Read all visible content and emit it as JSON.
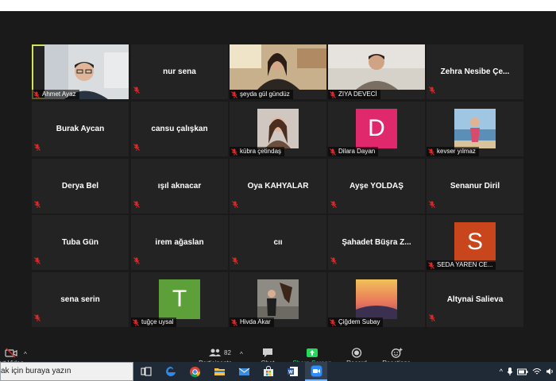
{
  "participants": [
    {
      "name": "Ahmet Ayaz",
      "muted": true,
      "video": true,
      "active_speaker": true,
      "label_style": "bottom"
    },
    {
      "name": "nur sena",
      "muted": true,
      "video": false
    },
    {
      "name": "şeyda gül gündüz",
      "muted": true,
      "video": true
    },
    {
      "name": "ZIYA DEVECİ",
      "muted": true,
      "video": true
    },
    {
      "name": "Zehra Nesibe Çe...",
      "muted": true,
      "video": false
    },
    {
      "name": "Burak Aycan",
      "muted": true,
      "video": false
    },
    {
      "name": "cansu çalışkan",
      "muted": true,
      "video": false
    },
    {
      "name": "kübra çetindaş",
      "muted": true,
      "video": true
    },
    {
      "name": "Dilara Dayan",
      "muted": true,
      "avatar_letter": "D",
      "avatar_color": "#e0286d"
    },
    {
      "name": "kevser yılmaz",
      "muted": true,
      "video": true
    },
    {
      "name": "Derya Bel",
      "muted": true,
      "video": false
    },
    {
      "name": "ışıl aknacar",
      "muted": true,
      "video": false
    },
    {
      "name": "Oya KAHYALAR",
      "muted": true,
      "video": false
    },
    {
      "name": "Ayşe YOLDAŞ",
      "muted": true,
      "video": false
    },
    {
      "name": "Senanur Diril",
      "muted": true,
      "video": false
    },
    {
      "name": "Tuba Gün",
      "muted": true,
      "video": false
    },
    {
      "name": "irem ağaslan",
      "muted": true,
      "video": false
    },
    {
      "name": "cıı",
      "muted": true,
      "video": false
    },
    {
      "name": "Şahadet Büşra Z...",
      "muted": true,
      "video": false
    },
    {
      "name": "SEDA YAREN CE...",
      "muted": true,
      "avatar_letter": "S",
      "avatar_color": "#c9451c"
    },
    {
      "name": "sena serin",
      "muted": true,
      "video": false
    },
    {
      "name": "tuğçe uysal",
      "muted": true,
      "avatar_letter": "T",
      "avatar_color": "#5da03a"
    },
    {
      "name": "Hivda Akar",
      "muted": true,
      "video": true
    },
    {
      "name": "Çiğdem Subay",
      "muted": true,
      "video": true
    },
    {
      "name": "Altynai Salieva",
      "muted": true,
      "video": false
    }
  ],
  "toolbar": {
    "start_video": "art Video",
    "participants": "Participants",
    "participants_count": "82",
    "chat": "Chat",
    "share_screen": "Share Screen",
    "record": "Record",
    "reactions": "Reactions",
    "share_color": "#23d959"
  },
  "taskbar": {
    "search_placeholder": "ak için buraya yazın"
  },
  "colors": {
    "mute_red": "#e02828",
    "active_border": "#d2e35a",
    "tile_bg": "#232323",
    "app_bg": "#1a1a1a"
  }
}
